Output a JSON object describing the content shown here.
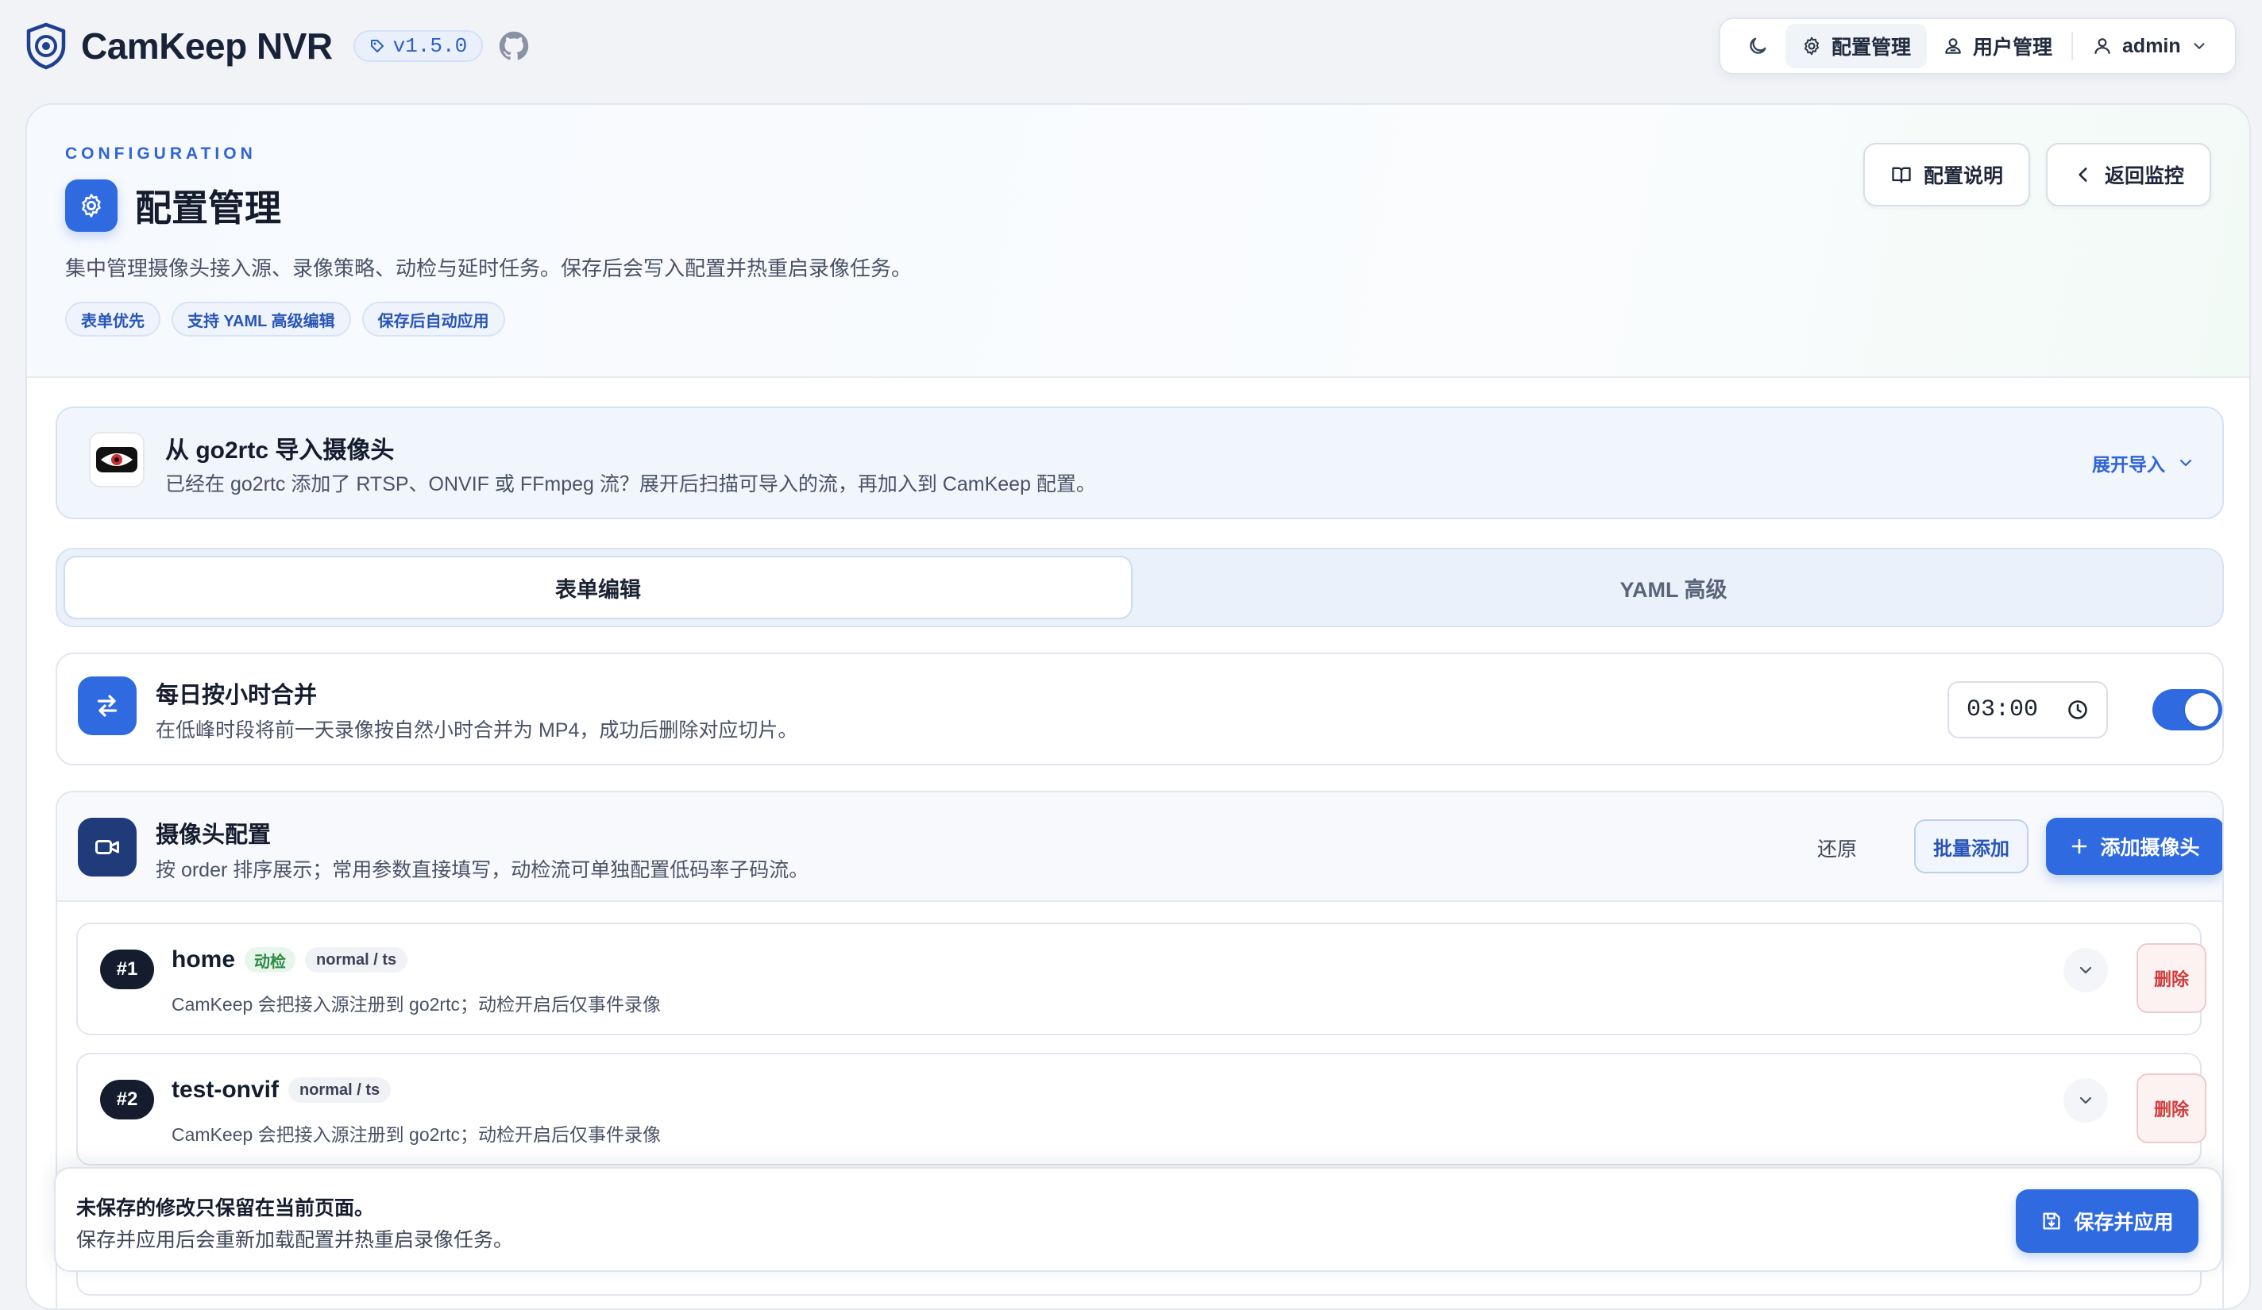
{
  "app": {
    "title": "CamKeep NVR",
    "version": "v1.5.0",
    "brand_color": "#2f6ae0"
  },
  "nav": {
    "theme_icon": "moon-icon",
    "items": [
      {
        "label": "配置管理",
        "icon": "gear-icon",
        "active": true
      },
      {
        "label": "用户管理",
        "icon": "users-icon",
        "active": false
      }
    ],
    "user": {
      "label": "admin",
      "icon": "user-icon"
    }
  },
  "header": {
    "eyebrow": "CONFIGURATION",
    "title": "配置管理",
    "description": "集中管理摄像头接入源、录像策略、动检与延时任务。保存后会写入配置并热重启录像任务。",
    "tags": [
      "表单优先",
      "支持 YAML 高级编辑",
      "保存后自动应用"
    ],
    "actions": {
      "docs_label": "配置说明",
      "back_label": "返回监控"
    }
  },
  "import": {
    "title": "从 go2rtc 导入摄像头",
    "description": "已经在 go2rtc 添加了 RTSP、ONVIF 或 FFmpeg 流？展开后扫描可导入的流，再加入到 CamKeep 配置。",
    "toggle_label": "展开导入"
  },
  "tabs": [
    {
      "label": "表单编辑",
      "active": true
    },
    {
      "label": "YAML 高级",
      "active": false
    }
  ],
  "merge": {
    "title": "每日按小时合并",
    "description": "在低峰时段将前一天录像按自然小时合并为 MP4，成功后删除对应切片。",
    "time": "03:00",
    "enabled": true
  },
  "cameras": {
    "title": "摄像头配置",
    "description": "按 order 排序展示；常用参数直接填写，动检流可单独配置低码率子码流。",
    "restore_label": "还原",
    "batch_label": "批量添加",
    "add_label": "添加摄像头",
    "items": [
      {
        "order": "#1",
        "name": "home",
        "motion_badge": "动检",
        "mode_badge": "normal / ts",
        "description": "CamKeep 会把接入源注册到 go2rtc；动检开启后仅事件录像",
        "delete_label": "删除"
      },
      {
        "order": "#2",
        "name": "test-onvif",
        "motion_badge": "",
        "mode_badge": "normal / ts",
        "description": "CamKeep 会把接入源注册到 go2rtc；动检开启后仅事件录像",
        "delete_label": "删除"
      }
    ]
  },
  "save_bar": {
    "line1": "未保存的修改只保留在当前页面。",
    "line2": "保存并应用后会重新加载配置并热重启录像任务。",
    "button_label": "保存并应用"
  }
}
